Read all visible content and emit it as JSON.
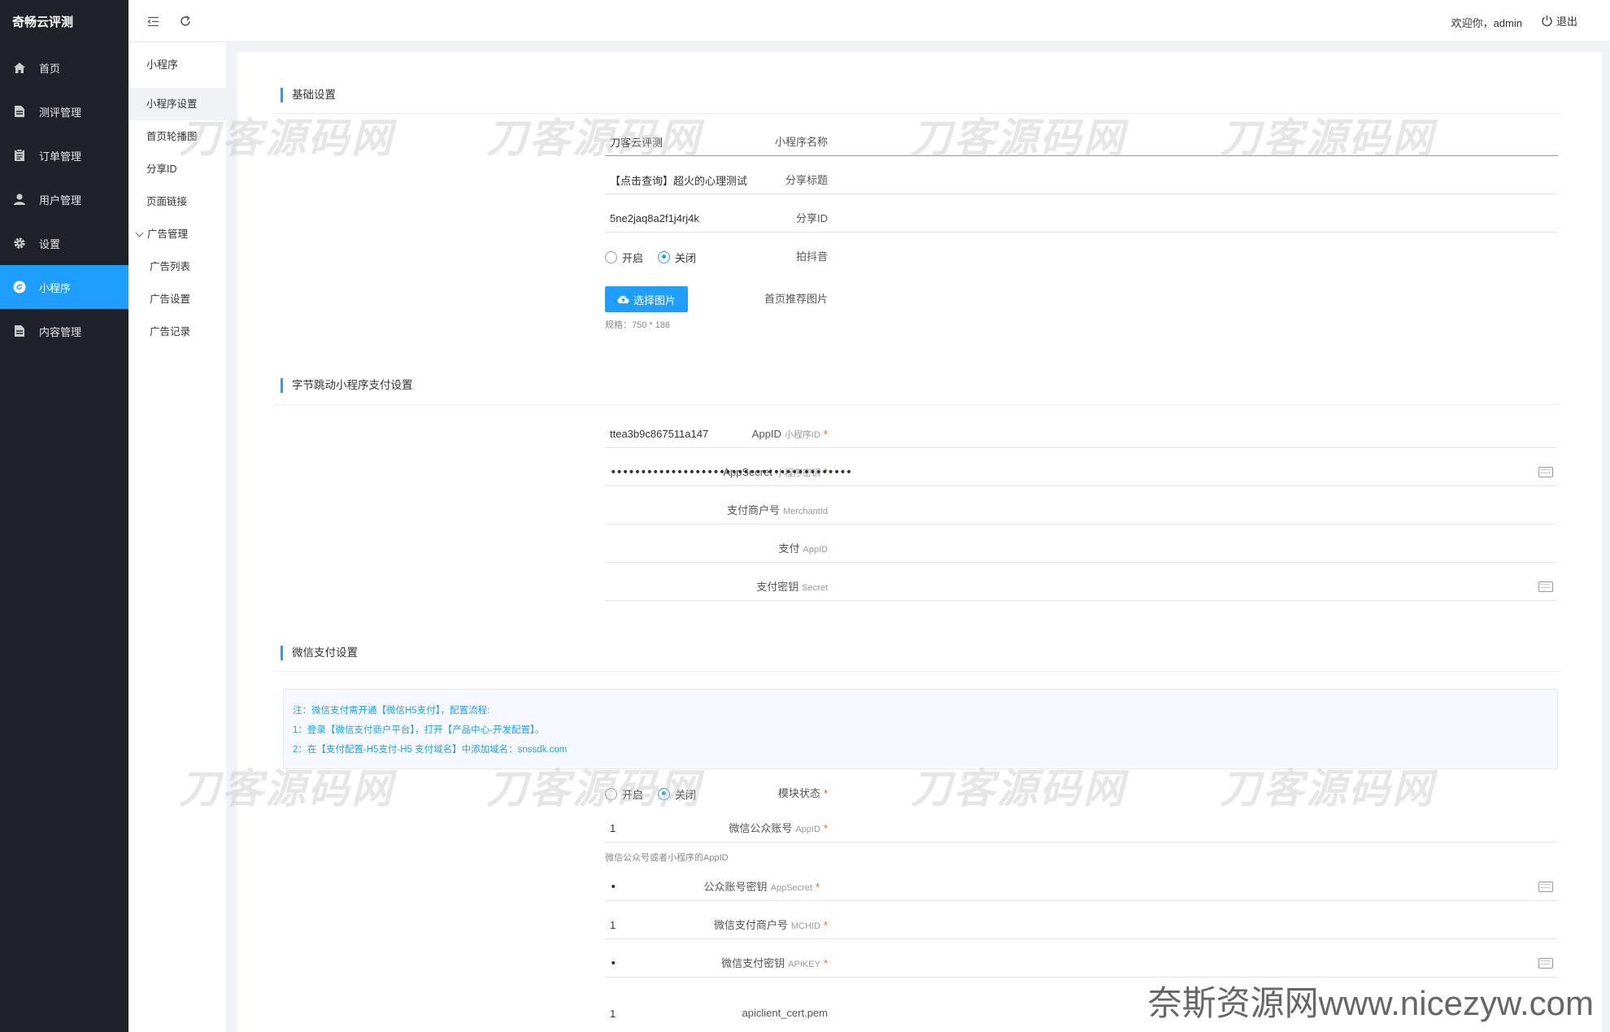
{
  "sidebar": {
    "brand": "奇畅云评测",
    "items": [
      {
        "label": "首页",
        "icon": "home-icon"
      },
      {
        "label": "测评管理",
        "icon": "document-icon"
      },
      {
        "label": "订单管理",
        "icon": "clipboard-icon"
      },
      {
        "label": "用户管理",
        "icon": "user-icon"
      },
      {
        "label": "设置",
        "icon": "gear-icon"
      },
      {
        "label": "小程序",
        "icon": "mini-program-icon",
        "active": true
      },
      {
        "label": "内容管理",
        "icon": "document-icon"
      }
    ]
  },
  "submenu": {
    "title": "小程序",
    "items": [
      "小程序设置",
      "首页轮播图",
      "分享ID",
      "页面链接"
    ],
    "group": "广告管理",
    "group_items": [
      "广告列表",
      "广告设置",
      "广告记录"
    ]
  },
  "topbar": {
    "welcome": "欢迎你，admin",
    "logout": "退出"
  },
  "basic": {
    "title": "基础设置",
    "name": {
      "label": "小程序名称",
      "value": "刀客云评测"
    },
    "share_title": {
      "label": "分享标题",
      "value": "【点击查询】超火的心理测试"
    },
    "share_id": {
      "label": "分享ID",
      "value": "5ne2jaq8a2f1j4rj4k"
    },
    "douyin": {
      "label": "拍抖音",
      "on": "开启",
      "off": "关闭"
    },
    "image": {
      "label": "首页推荐图片",
      "button": "选择图片",
      "hint": "规格：750 * 186"
    }
  },
  "bytedance": {
    "title": "字节跳动小程序支付设置",
    "appid": {
      "label": "AppID",
      "en": "小程序ID",
      "req": "*",
      "value": "ttea3b9c867511a147"
    },
    "appsecret": {
      "label": "AppSecret",
      "en": "小程序密钥",
      "req": "*",
      "value": "••••••••••••••••••••••••••••••••••••••••"
    },
    "merchant": {
      "label": "支付商户号",
      "en": "MerchantId",
      "value": ""
    },
    "pay_appid": {
      "label": "支付",
      "en": "AppID",
      "value": ""
    },
    "secret": {
      "label": "支付密钥",
      "en": "Secret",
      "value": ""
    }
  },
  "wechat": {
    "title": "微信支付设置",
    "notice": [
      "注：微信支付需开通【微信H5支付】，配置流程:",
      "1：登录【微信支付商户平台】，打开【产品中心-开发配置】。",
      "2：在【支付配置-H5支付-H5 支付域名】中添加域名：snssdk.com"
    ],
    "status": {
      "label": "模块状态",
      "req": "*",
      "on": "开启",
      "off": "关闭"
    },
    "appid": {
      "label": "微信公众账号",
      "en": "AppID",
      "req": "*",
      "value": "1",
      "hint": "微信公众号或者小程序的AppID"
    },
    "appsecret": {
      "label": "公众账号密钥",
      "en": "AppSecret",
      "req": "*",
      "value": "•"
    },
    "mchid": {
      "label": "微信支付商户号",
      "en": "MCHID",
      "req": "*",
      "value": "1"
    },
    "apikey": {
      "label": "微信支付密钥",
      "en": "APIKEY",
      "req": "*",
      "value": "•"
    },
    "cert": {
      "label": "apiclient_cert.pem",
      "value": "1"
    }
  },
  "watermark": {
    "text": "刀客源码网",
    "footer": "奈斯资源网www.nicezyw.com"
  }
}
